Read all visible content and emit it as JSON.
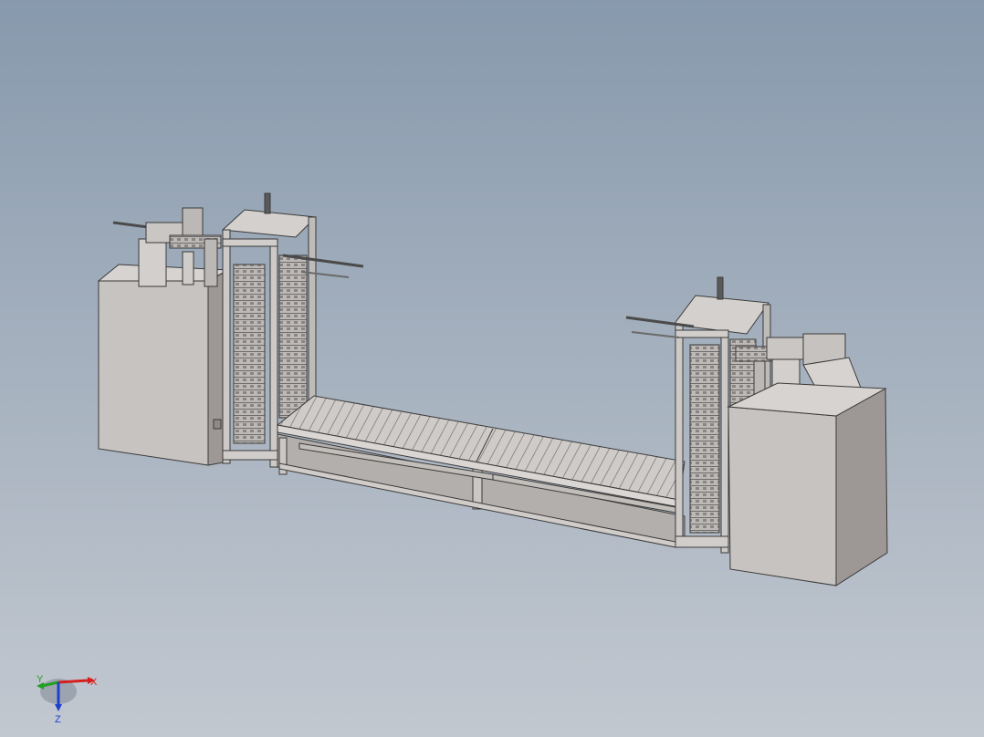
{
  "viewport": {
    "background_top": "#8799ad",
    "background_bottom": "#c2c8d0"
  },
  "model": {
    "assembly": "conveyor-lift-line",
    "part_face_light": "#d9d6d3",
    "part_face_mid": "#bcb8b5",
    "part_face_dark": "#8f8a88",
    "edge_color": "#3a3a3a"
  },
  "triad": {
    "x_label": "X",
    "y_label": "Y",
    "z_label": "Z",
    "x_color": "#d62020",
    "y_color": "#22a022",
    "z_color": "#2040d0"
  }
}
